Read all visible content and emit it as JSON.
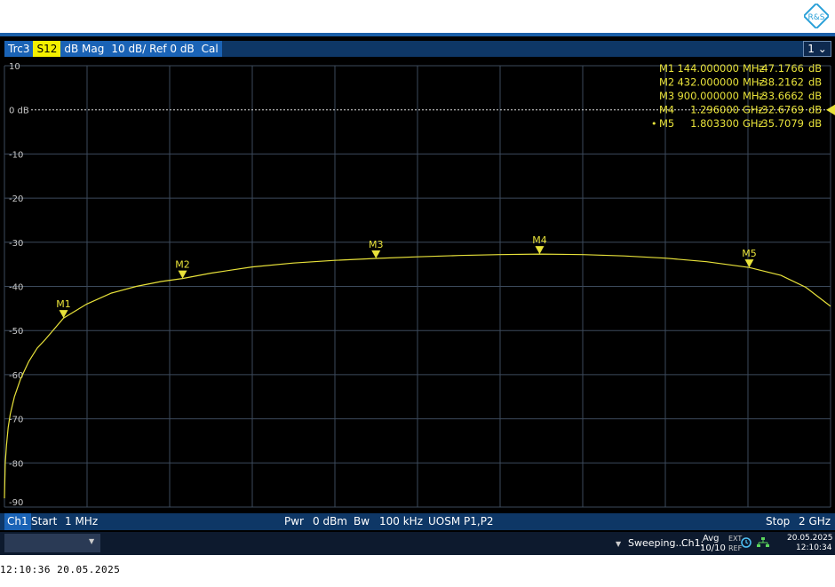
{
  "brand": {
    "logo_text": "R&S"
  },
  "trace_bar": {
    "trace": "Trc3",
    "param": "S12",
    "format": "dB Mag",
    "scale": "10 dB/ Ref 0 dB",
    "cal": "Cal",
    "channel_select": "1"
  },
  "bottom_bar": {
    "channel": "Ch1",
    "start_label": "Start",
    "start_value": "1 MHz",
    "pwr_label": "Pwr",
    "pwr_value": "0 dBm",
    "bw_label": "Bw",
    "bw_value": "100 kHz",
    "port_config": "UOSM P1,P2",
    "stop_label": "Stop",
    "stop_value": "2 GHz"
  },
  "status_bar": {
    "sweeping": "Sweeping...",
    "channel": "Ch1:",
    "avg_label": "Avg",
    "avg_value": "10/10",
    "ext_label": "EXT",
    "ref_label": "REF",
    "date": "20.05.2025",
    "time": "12:10:34"
  },
  "footer": {
    "timestamp": "12:10:36  20.05.2025"
  },
  "colors": {
    "trace": "#e8e23a",
    "grid": "#3c4a5c",
    "background": "#000000",
    "accent": "#1a63b6"
  },
  "chart_data": {
    "type": "line",
    "title": "",
    "xlabel": "",
    "ylabel": "",
    "x_unit": "MHz",
    "xlim": [
      1,
      2000
    ],
    "ylim": [
      -90,
      10
    ],
    "y_ticks": [
      10,
      0,
      -10,
      -20,
      -30,
      -40,
      -50,
      -60,
      -70,
      -80,
      -90
    ],
    "y_tick_labels": [
      "10",
      "0 dB",
      "-10",
      "-20",
      "-30",
      "-40",
      "-50",
      "-60",
      "-70",
      "-80",
      "-90"
    ],
    "reference_level": 0,
    "grid": true,
    "series": [
      {
        "name": "",
        "x": [
          1,
          3,
          6,
          10,
          15,
          25,
          40,
          60,
          80,
          100,
          144,
          200,
          260,
          320,
          380,
          432,
          500,
          600,
          700,
          800,
          900,
          1000,
          1100,
          1200,
          1296,
          1400,
          1500,
          1600,
          1700,
          1803,
          1880,
          1940,
          2000
        ],
        "y": [
          -88,
          -80,
          -76,
          -72,
          -69,
          -65,
          -61,
          -57,
          -54,
          -52,
          -47.1766,
          -44,
          -41.5,
          -40,
          -38.9,
          -38.2162,
          -37,
          -35.6,
          -34.7,
          -34.1,
          -33.6662,
          -33.3,
          -33,
          -32.8,
          -32.6769,
          -32.8,
          -33.1,
          -33.6,
          -34.4,
          -35.7079,
          -37.5,
          -40.2,
          -44.5
        ]
      }
    ],
    "markers": [
      {
        "label": "M1",
        "x": 144,
        "y": -47.1766,
        "freq": "144.000000",
        "unit": "MHz",
        "value": "-47.1766",
        "db": "dB"
      },
      {
        "label": "M2",
        "x": 432,
        "y": -38.2162,
        "freq": "432.000000",
        "unit": "MHz",
        "value": "-38.2162",
        "db": "dB"
      },
      {
        "label": "M3",
        "x": 900,
        "y": -33.6662,
        "freq": "900.000000",
        "unit": "MHz",
        "value": "-33.6662",
        "db": "dB"
      },
      {
        "label": "M4",
        "x": 1296,
        "y": -32.6769,
        "freq": "1.296000",
        "unit": "GHz",
        "value": "-32.6769",
        "db": "dB"
      },
      {
        "label": "M5",
        "x": 1803.3,
        "y": -35.7079,
        "freq": "1.803300",
        "unit": "GHz",
        "value": "-35.7079",
        "db": "dB",
        "active": true
      }
    ]
  }
}
